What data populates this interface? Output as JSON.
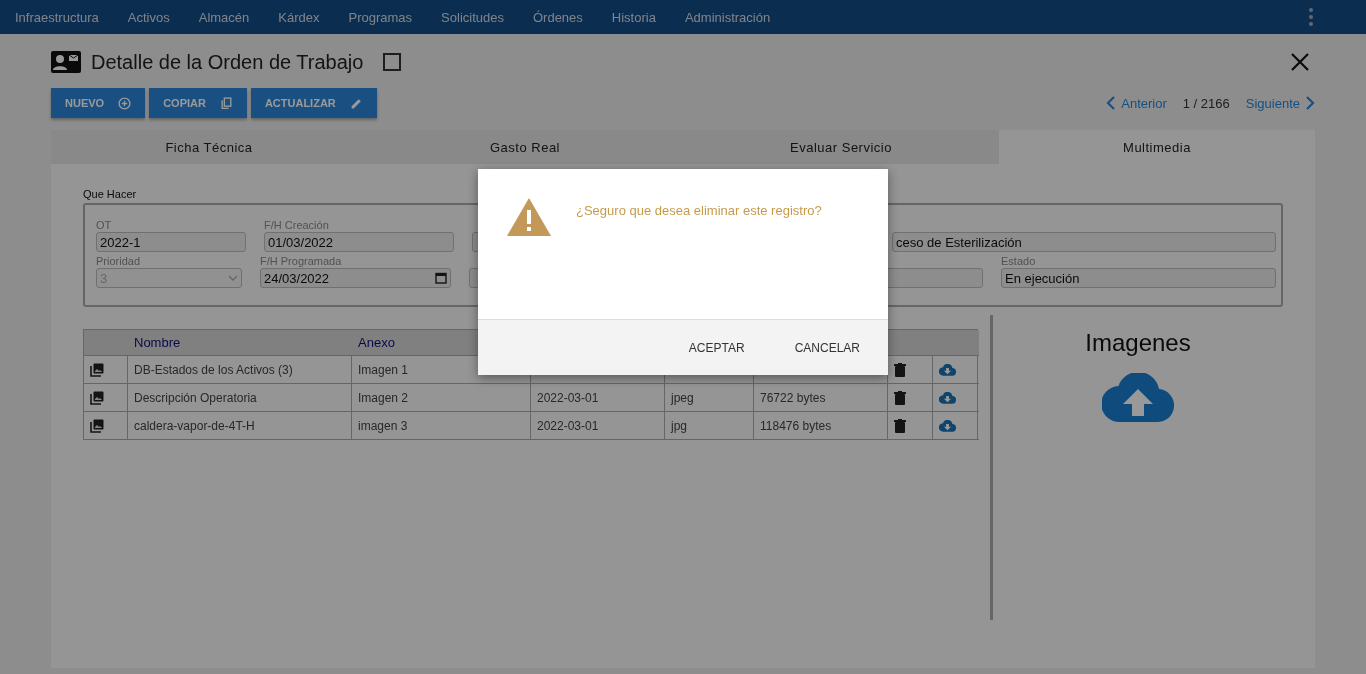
{
  "nav": {
    "items": [
      "Infraestructura",
      "Activos",
      "Almacén",
      "Kárdex",
      "Programas",
      "Solicitudes",
      "Órdenes",
      "Historia",
      "Administración"
    ]
  },
  "header": {
    "title": "Detalle de la Orden de Trabajo",
    "checked": false
  },
  "actions": [
    {
      "label": "NUEVO",
      "kind": "new"
    },
    {
      "label": "COPIAR",
      "kind": "copy"
    },
    {
      "label": "ACTUALIZAR",
      "kind": "edit"
    }
  ],
  "pager": {
    "previous": "Anterior",
    "position": "1 / 2166",
    "next": "Siguiente"
  },
  "tabs": [
    {
      "label": "Ficha Técnica",
      "selected": false
    },
    {
      "label": "Gasto Real",
      "selected": false
    },
    {
      "label": "Evaluar Servicio",
      "selected": false
    },
    {
      "label": "Multimedia",
      "selected": true
    }
  ],
  "form": {
    "legend": "Que Hacer",
    "rows": [
      [
        {
          "label": "OT",
          "value": "2022-1",
          "kind": "text"
        },
        {
          "label": "F/H Creación",
          "value": "01/03/2022",
          "kind": "text"
        },
        {
          "kind": "hidden"
        },
        {
          "value": "ceso de Esterilización",
          "kind": "text"
        }
      ],
      [
        {
          "label": "Prioridad",
          "value": "3",
          "kind": "select",
          "disabled": true
        },
        {
          "label": "F/H Programada",
          "value": "24/03/2022",
          "kind": "date"
        },
        {
          "kind": "hidden"
        },
        {
          "kind": "text"
        },
        {
          "label": "Estado",
          "value": "En ejecución",
          "kind": "text"
        }
      ]
    ]
  },
  "table": {
    "columns": [
      "Nombre",
      "Anexo"
    ],
    "rows": [
      {
        "name": "DB-Estados de los Activos (3)",
        "attachment": "Imagen 1"
      },
      {
        "name": "Descripción Operatoria",
        "attachment": "Imagen 2",
        "date": "2022-03-01",
        "type": "jpeg",
        "size": "76722 bytes"
      },
      {
        "name": "caldera-vapor-de-4T-H",
        "attachment": "imagen 3",
        "date": "2022-03-01",
        "type": "jpg",
        "size": "118476 bytes"
      }
    ]
  },
  "images_panel": {
    "title": "Imagenes"
  },
  "dialog": {
    "message": "¿Seguro que desea eliminar este registro?",
    "buttons": [
      "ACEPTAR",
      "CANCELAR"
    ]
  }
}
